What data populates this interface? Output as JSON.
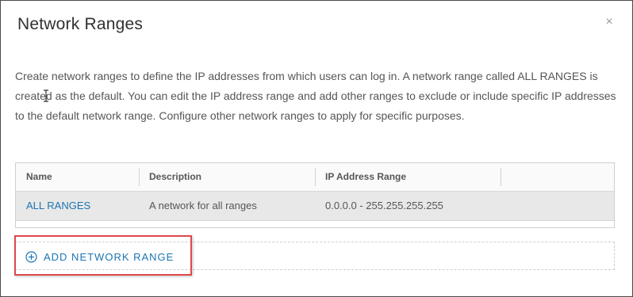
{
  "dialog": {
    "title": "Network Ranges",
    "close_glyph": "×",
    "description_part1": "Create network ranges to define the IP addresses from which users can log in. A network range called ALL RANGES is create",
    "description_part2": "d as the default. You can edit the IP address range and add other ranges to exclude or include specific IP addresses to the default network range. Configure other network ranges to apply for specific purposes."
  },
  "table": {
    "columns": [
      "Name",
      "Description",
      "IP Address Range"
    ],
    "rows": [
      {
        "name": "ALL RANGES",
        "description": "A network for all ranges",
        "ip_range": "0.0.0.0 - 255.255.255.255"
      }
    ]
  },
  "add_button": {
    "label": "ADD NETWORK RANGE",
    "icon": "plus-circle-icon"
  },
  "colors": {
    "link": "#1b75b3",
    "highlight": "#e0484a",
    "row_selected": "#e8e8e8"
  }
}
